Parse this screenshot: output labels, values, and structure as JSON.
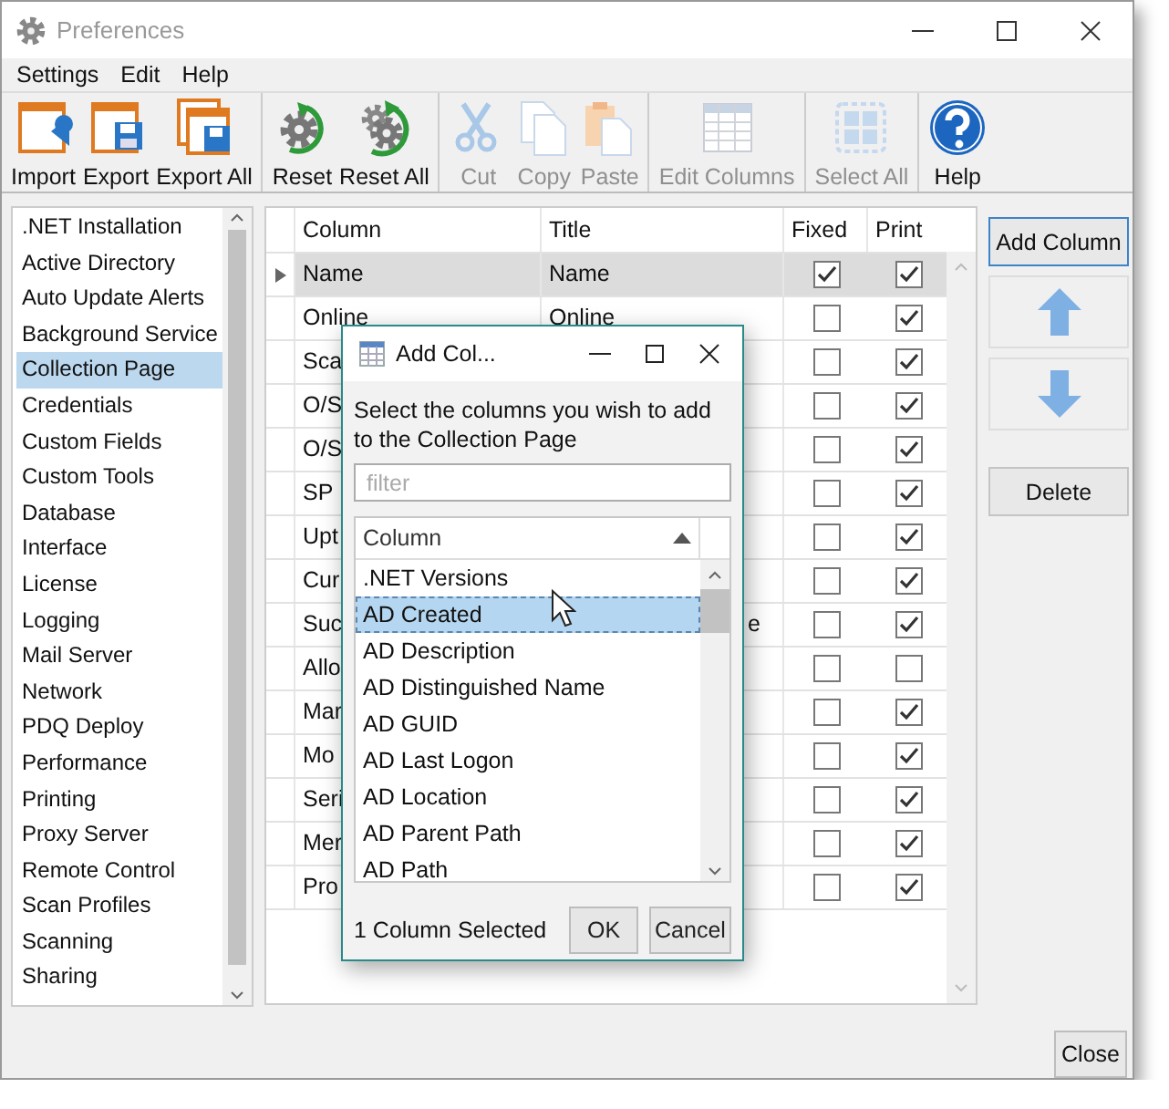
{
  "window": {
    "title": "Preferences"
  },
  "menu": [
    {
      "label": "Settings"
    },
    {
      "label": "Edit"
    },
    {
      "label": "Help"
    }
  ],
  "toolbar": {
    "groups": [
      [
        {
          "label": "Import",
          "disabled": false
        },
        {
          "label": "Export",
          "disabled": false
        },
        {
          "label": "Export All",
          "disabled": false
        }
      ],
      [
        {
          "label": "Reset",
          "disabled": false
        },
        {
          "label": "Reset All",
          "disabled": false
        }
      ],
      [
        {
          "label": "Cut",
          "disabled": true
        },
        {
          "label": "Copy",
          "disabled": true
        },
        {
          "label": "Paste",
          "disabled": true
        }
      ],
      [
        {
          "label": "Edit Columns",
          "disabled": true
        }
      ],
      [
        {
          "label": "Select All",
          "disabled": true
        }
      ],
      [
        {
          "label": "Help",
          "disabled": false
        }
      ]
    ]
  },
  "sidebar": {
    "items": [
      {
        "label": ".NET Installation",
        "selected": false
      },
      {
        "label": "Active Directory",
        "selected": false
      },
      {
        "label": "Auto Update Alerts",
        "selected": false
      },
      {
        "label": "Background Service",
        "selected": false
      },
      {
        "label": "Collection Page",
        "selected": true
      },
      {
        "label": "Credentials",
        "selected": false
      },
      {
        "label": "Custom Fields",
        "selected": false
      },
      {
        "label": "Custom Tools",
        "selected": false
      },
      {
        "label": "Database",
        "selected": false
      },
      {
        "label": "Interface",
        "selected": false
      },
      {
        "label": "License",
        "selected": false
      },
      {
        "label": "Logging",
        "selected": false
      },
      {
        "label": "Mail Server",
        "selected": false
      },
      {
        "label": "Network",
        "selected": false
      },
      {
        "label": "PDQ Deploy",
        "selected": false
      },
      {
        "label": "Performance",
        "selected": false
      },
      {
        "label": "Printing",
        "selected": false
      },
      {
        "label": "Proxy Server",
        "selected": false
      },
      {
        "label": "Remote Control",
        "selected": false
      },
      {
        "label": "Scan Profiles",
        "selected": false
      },
      {
        "label": "Scanning",
        "selected": false
      },
      {
        "label": "Sharing",
        "selected": false
      }
    ]
  },
  "grid": {
    "columns": [
      "Column",
      "Title",
      "Fixed",
      "Print"
    ],
    "rows": [
      {
        "column": "Name",
        "title": "Name",
        "fixed": true,
        "print": true,
        "selected": true
      },
      {
        "column": "Online",
        "title": "Online",
        "fixed": false,
        "print": true,
        "selected": false
      },
      {
        "column": "Sca",
        "fixed": false,
        "print": true,
        "selected": false
      },
      {
        "column": "O/S",
        "fixed": false,
        "print": true,
        "selected": false
      },
      {
        "column": "O/S",
        "fixed": false,
        "print": true,
        "selected": false
      },
      {
        "column": "SP",
        "fixed": false,
        "print": true,
        "selected": false
      },
      {
        "column": "Upt",
        "fixed": false,
        "print": true,
        "selected": false
      },
      {
        "column": "Cur",
        "fixed": false,
        "print": true,
        "selected": false
      },
      {
        "column": "Suc",
        "title": "e",
        "fixed": false,
        "print": true,
        "selected": false
      },
      {
        "column": "Allo",
        "fixed": false,
        "print": false,
        "selected": false
      },
      {
        "column": "Mar",
        "fixed": false,
        "print": true,
        "selected": false
      },
      {
        "column": "Mo",
        "fixed": false,
        "print": true,
        "selected": false
      },
      {
        "column": "Seri",
        "fixed": false,
        "print": true,
        "selected": false
      },
      {
        "column": "Mer",
        "fixed": false,
        "print": true,
        "selected": false
      },
      {
        "column": "Pro",
        "fixed": false,
        "print": true,
        "selected": false
      }
    ]
  },
  "side_buttons": [
    {
      "kind": "text",
      "label": "Add Column",
      "focused": true
    },
    {
      "kind": "up",
      "focused": false
    },
    {
      "kind": "down",
      "focused": false
    },
    {
      "kind": "text",
      "label": "Delete",
      "focused": false
    }
  ],
  "close_button": {
    "label": "Close"
  },
  "dialog": {
    "title": "Add Col...",
    "instructions": "Select the columns you wish to add to the Collection Page",
    "filter": {
      "placeholder": "filter"
    },
    "list": {
      "header": "Column",
      "items": [
        {
          "label": ".NET Versions",
          "selected": false
        },
        {
          "label": "AD Created",
          "selected": true
        },
        {
          "label": "AD Description",
          "selected": false
        },
        {
          "label": "AD Distinguished Name",
          "selected": false
        },
        {
          "label": "AD GUID",
          "selected": false
        },
        {
          "label": "AD Last Logon",
          "selected": false
        },
        {
          "label": "AD Location",
          "selected": false
        },
        {
          "label": "AD Parent Path",
          "selected": false
        },
        {
          "label": "AD Path",
          "selected": false
        }
      ]
    },
    "status": "1 Column Selected",
    "buttons": [
      {
        "label": "OK"
      },
      {
        "label": "Cancel"
      }
    ]
  }
}
